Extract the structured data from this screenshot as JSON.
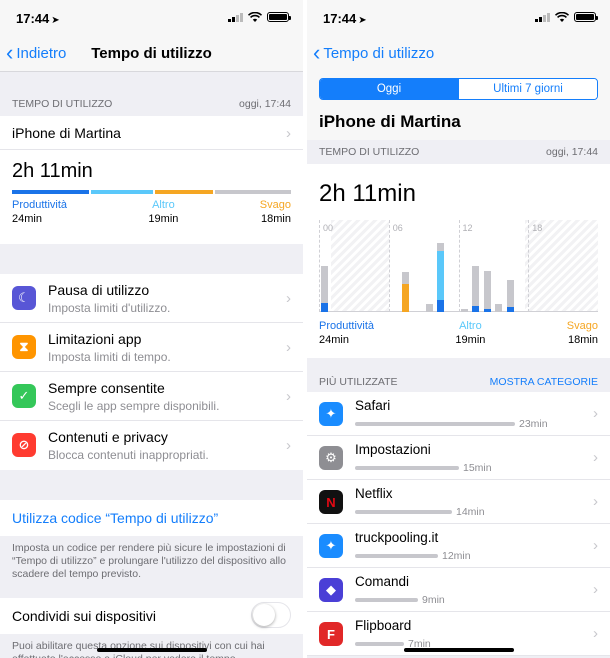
{
  "left": {
    "status": {
      "time": "17:44"
    },
    "nav": {
      "back": "Indietro",
      "title": "Tempo di utilizzo"
    },
    "usage": {
      "header": "TEMPO DI UTILIZZO",
      "updated": "oggi, 17:44",
      "device": "iPhone di Martina",
      "total": "2h 11min",
      "categories": [
        {
          "name": "Produttività",
          "value": "24min",
          "color": "#1a73e8"
        },
        {
          "name": "Altro",
          "value": "19min",
          "color": "#5ac8fa"
        },
        {
          "name": "Svago",
          "value": "18min",
          "color": "#f5a623"
        }
      ]
    },
    "options": [
      {
        "title": "Pausa di utilizzo",
        "subtitle": "Imposta limiti d'utilizzo.",
        "icon": "moon-icon",
        "color": "#5856d6"
      },
      {
        "title": "Limitazioni app",
        "subtitle": "Imposta limiti di tempo.",
        "icon": "hourglass-icon",
        "color": "#ff9500"
      },
      {
        "title": "Sempre consentite",
        "subtitle": "Scegli le app sempre disponibili.",
        "icon": "checkmark-shield-icon",
        "color": "#34c759"
      },
      {
        "title": "Contenuti e privacy",
        "subtitle": "Blocca contenuti inappropriati.",
        "icon": "restriction-icon",
        "color": "#ff3b30"
      }
    ],
    "passcode": {
      "link": "Utilizza codice “Tempo di utilizzo”",
      "footnote": "Imposta un codice per rendere più sicure le impostazioni di “Tempo di utilizzo” e prolungare l'utilizzo del dispositivo allo scadere del tempo previsto."
    },
    "share": {
      "label": "Condividi sui dispositivi",
      "footnote": "Puoi abilitare questa opzione sui dispositivi con cui hai effettuato l'accesso a iCloud per vedere il tempo"
    }
  },
  "right": {
    "status": {
      "time": "17:44"
    },
    "nav": {
      "back": "Tempo di utilizzo"
    },
    "segments": {
      "today": "Oggi",
      "week": "Ultimi 7 giorni"
    },
    "device_title": "iPhone di Martina",
    "usage": {
      "header": "TEMPO DI UTILIZZO",
      "updated": "oggi, 17:44",
      "total": "2h 11min",
      "categories": [
        {
          "name": "Produttività",
          "value": "24min",
          "color": "#1a73e8"
        },
        {
          "name": "Altro",
          "value": "19min",
          "color": "#5ac8fa"
        },
        {
          "name": "Svago",
          "value": "18min",
          "color": "#f5a623"
        }
      ]
    },
    "chart_data": {
      "type": "bar",
      "x_tick_labels": [
        "00",
        "06",
        "12",
        "18"
      ],
      "ylim": [
        0,
        60
      ],
      "series_colors": {
        "Produttività": "#1a73e8",
        "Altro": "#5ac8fa",
        "Svago": "#f5a623",
        "other": "#c7c7cc"
      },
      "bars": [
        {
          "hour": 0,
          "Produttività": 6,
          "Altro": 0,
          "Svago": 0,
          "other": 24
        },
        {
          "hour": 7,
          "Produttività": 0,
          "Altro": 0,
          "Svago": 18,
          "other": 8
        },
        {
          "hour": 9,
          "Produttività": 0,
          "Altro": 0,
          "Svago": 0,
          "other": 5
        },
        {
          "hour": 10,
          "Produttività": 8,
          "Altro": 32,
          "Svago": 0,
          "other": 5
        },
        {
          "hour": 12,
          "Produttività": 0,
          "Altro": 0,
          "Svago": 0,
          "other": 2
        },
        {
          "hour": 13,
          "Produttività": 4,
          "Altro": 0,
          "Svago": 0,
          "other": 26
        },
        {
          "hour": 14,
          "Produttività": 2,
          "Altro": 0,
          "Svago": 0,
          "other": 25
        },
        {
          "hour": 15,
          "Produttività": 0,
          "Altro": 0,
          "Svago": 0,
          "other": 5
        },
        {
          "hour": 16,
          "Produttività": 3,
          "Altro": 0,
          "Svago": 0,
          "other": 18
        }
      ]
    },
    "most_used": {
      "header": "PIÙ UTILIZZATE",
      "action": "MOSTRA CATEGORIE",
      "apps": [
        {
          "name": "Safari",
          "time": "23min",
          "minutes": 23,
          "icon": "compass-icon",
          "color": "#1a8cff"
        },
        {
          "name": "Impostazioni",
          "time": "15min",
          "minutes": 15,
          "icon": "gear-icon",
          "color": "#8e8e93"
        },
        {
          "name": "Netflix",
          "time": "14min",
          "minutes": 14,
          "icon": "netflix-icon",
          "color": "#111111"
        },
        {
          "name": "truckpooling.it",
          "time": "12min",
          "minutes": 12,
          "icon": "compass-icon",
          "color": "#1a8cff"
        },
        {
          "name": "Comandi",
          "time": "9min",
          "minutes": 9,
          "icon": "shortcuts-icon",
          "color": "#4a3fd6"
        },
        {
          "name": "Flipboard",
          "time": "7min",
          "minutes": 7,
          "icon": "flipboard-icon",
          "color": "#e12828"
        }
      ]
    }
  }
}
